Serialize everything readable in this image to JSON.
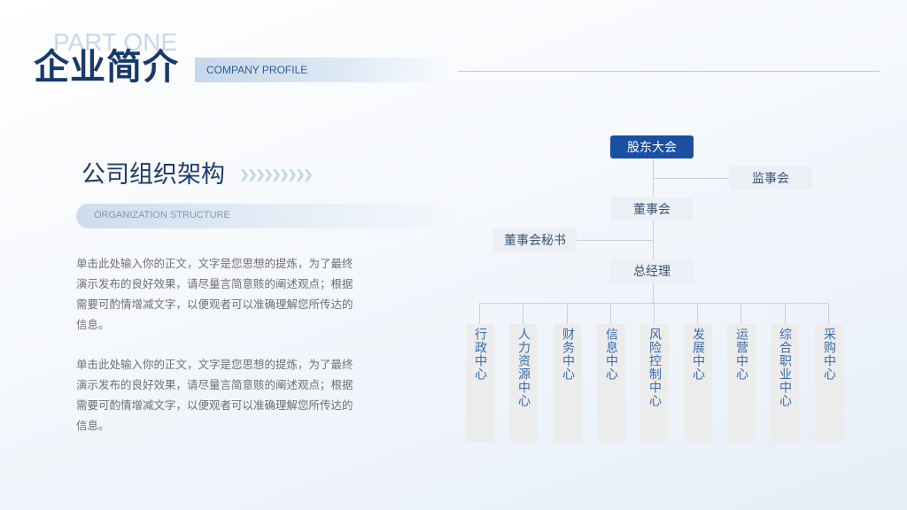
{
  "header": {
    "part_label": "PART ONE",
    "title": "企业简介",
    "subtitle": "COMPANY PROFILE"
  },
  "section": {
    "title": "公司组织架构",
    "subtitle": "ORGANIZATION STRUCTURE",
    "paragraphs": [
      "单击此处输入你的正文，文字是您思想的提炼，为了最终演示发布的良好效果，请尽量言简意赅的阐述观点；根据需要可酌情增减文字，以便观者可以准确理解您所传达的信息。",
      "单击此处输入你的正文，文字是您思想的提炼，为了最终演示发布的良好效果，请尽量言简意赅的阐述观点；根据需要可酌情增减文字，以便观者可以准确理解您所传达的信息。"
    ]
  },
  "org": {
    "shareholders": "股东大会",
    "supervisors": "监事会",
    "board": "董事会",
    "board_secretary": "董事会秘书",
    "gm": "总经理",
    "departments": [
      "行政中心",
      "人力资源中心",
      "财务中心",
      "信息中心",
      "风险控制中心",
      "发展中心",
      "运营中心",
      "综合职业中心",
      "采购中心"
    ]
  },
  "colors": {
    "primary": "#1a4fa3",
    "title": "#173a6b",
    "node_bg": "#eceff3",
    "dept_text": "#3a6aa8"
  }
}
